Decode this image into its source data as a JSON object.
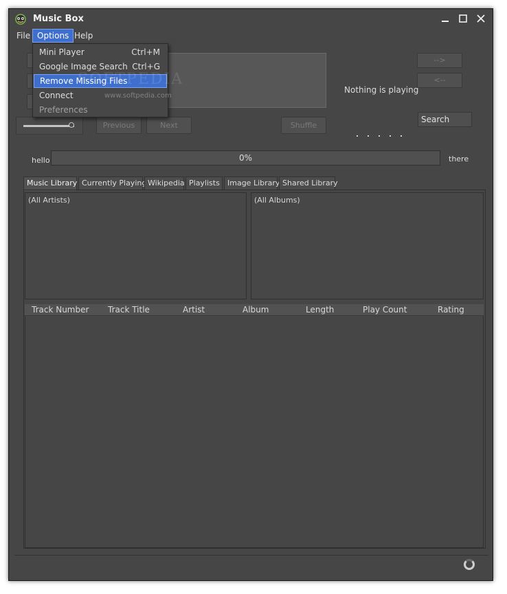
{
  "window": {
    "title": "Music Box"
  },
  "menubar": {
    "file": "File",
    "options": "Options",
    "help": "Help"
  },
  "options_menu": [
    {
      "label": "Mini Player",
      "shortcut": "Ctrl+M"
    },
    {
      "label": "Google Image Search",
      "shortcut": "Ctrl+G"
    },
    {
      "label": "Remove Missing Files",
      "shortcut": ""
    },
    {
      "label": "Connect",
      "shortcut": ""
    },
    {
      "label": "Preferences",
      "shortcut": ""
    }
  ],
  "controls": {
    "previous": "Previous",
    "next": "Next",
    "shuffle": "Shuffle",
    "forward": "-->",
    "back": "<--",
    "search": "Search",
    "now_playing": "Nothing is playing",
    "volume": 0.95
  },
  "progress": {
    "left_label": "hello",
    "right_label": "there",
    "text": "0%",
    "value": 0
  },
  "tabs": [
    "Music Library",
    "Currently Playing",
    "Wikipedia",
    "Playlists",
    "Image Library",
    "Shared Library"
  ],
  "library": {
    "artists": "(All Artists)",
    "albums": "(All Albums)"
  },
  "table": {
    "columns": [
      "Track Number",
      "Track Title",
      "Artist",
      "Album",
      "Length",
      "Play Count",
      "Rating"
    ]
  },
  "watermark": {
    "logo": "SOFTPEDIA",
    "url": "www.softpedia.com"
  },
  "colors": {
    "window_bg": "#464646",
    "accent": "#3f6fce",
    "accent_border": "#7da2f0"
  }
}
